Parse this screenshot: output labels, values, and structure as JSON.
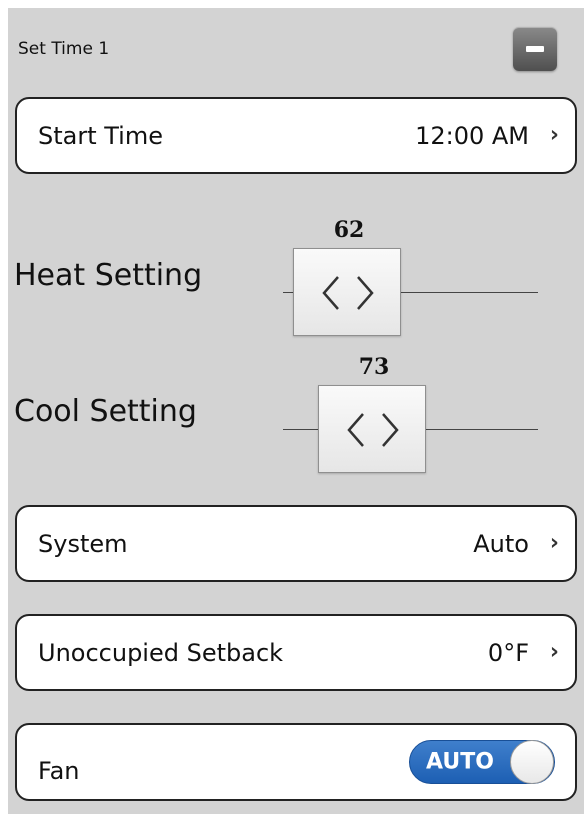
{
  "header": {
    "title": "Set Time 1",
    "minus_icon": "minus-icon"
  },
  "start_time": {
    "label": "Start Time",
    "value": "12:00 AM",
    "chevron": "›"
  },
  "heat": {
    "label": "Heat Setting",
    "value": "62"
  },
  "cool": {
    "label": "Cool Setting",
    "value": "73"
  },
  "system": {
    "label": "System",
    "value": "Auto",
    "chevron": "›"
  },
  "unoccupied": {
    "label": "Unoccupied Setback",
    "value": "0°F",
    "chevron": "›"
  },
  "fan": {
    "label": "Fan",
    "toggle_label": "AUTO",
    "toggle_color": "#2a6bbf"
  },
  "colors": {
    "panel_bg": "#d3d3d3",
    "row_bg": "#ffffff",
    "accent": "#2a6bbf"
  }
}
